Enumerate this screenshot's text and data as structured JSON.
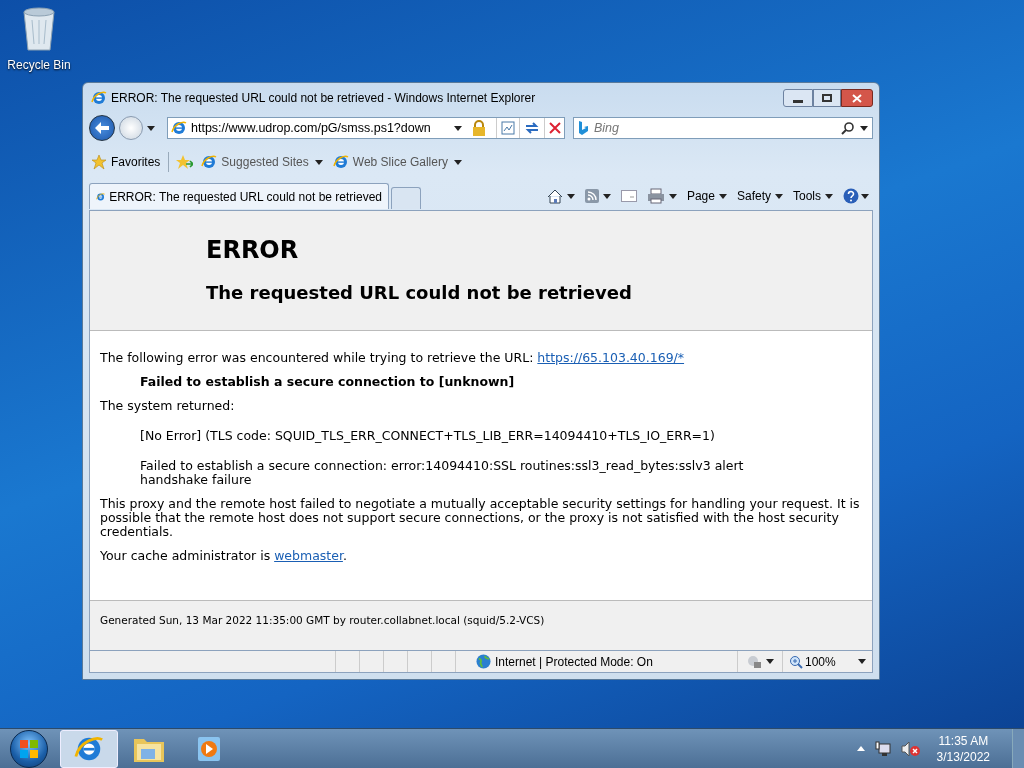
{
  "desktop": {
    "icons": [
      {
        "label": "Recycle Bin"
      }
    ]
  },
  "window": {
    "title": "ERROR: The requested URL could not be retrieved - Windows Internet Explorer",
    "address": {
      "url": "https://www.udrop.com/pG/smss.ps1?down"
    },
    "search": {
      "placeholder": "Bing"
    },
    "favorites_bar": {
      "favorites": "Favorites",
      "items": [
        "Suggested Sites",
        "Web Slice Gallery"
      ]
    },
    "tabs": [
      {
        "title": "ERROR: The requested URL could not be retrieved",
        "selected": true
      }
    ],
    "command_bar": [
      "Page",
      "Safety",
      "Tools"
    ],
    "page": {
      "heading": "ERROR",
      "subheading": "The requested URL could not be retrieved",
      "blocks": [
        {
          "kind": "para",
          "text": "The following error was encountered while trying to retrieve the URL: ",
          "link": "https://65.103.40.169/*"
        },
        {
          "kind": "indent-bold",
          "text": "Failed to establish a secure connection to [unknown]"
        },
        {
          "kind": "para",
          "text": "The system returned:"
        },
        {
          "kind": "indent",
          "text": "[No Error] (TLS code: SQUID_TLS_ERR_CONNECT+TLS_LIB_ERR=14094410+TLS_IO_ERR=1)"
        },
        {
          "kind": "indent",
          "text": "Failed to establish a secure connection: error:14094410:SSL routines:ssl3_read_bytes:sslv3 alert handshake failure"
        },
        {
          "kind": "para",
          "text": "This proxy and the remote host failed to negotiate a mutually acceptable security settings for handling your request. It is possible that the remote host does not support secure connections, or the proxy is not satisfied with the host security credentials."
        },
        {
          "kind": "para",
          "text": "Your cache administrator is ",
          "link": "webmaster",
          "after": "."
        }
      ],
      "footer": "Generated Sun, 13 Mar 2022 11:35:00 GMT by router.collabnet.local (squid/5.2-VCS)"
    },
    "status_bar": {
      "zone": "Internet | Protected Mode: On",
      "zoom": "100%"
    }
  },
  "taskbar": {
    "apps": [
      {
        "kind": "browser",
        "selected": true
      },
      {
        "kind": "folder",
        "selected": false
      },
      {
        "kind": "media",
        "selected": false
      }
    ],
    "clock": {
      "time": "11:35 AM",
      "date": "3/13/2022"
    }
  }
}
